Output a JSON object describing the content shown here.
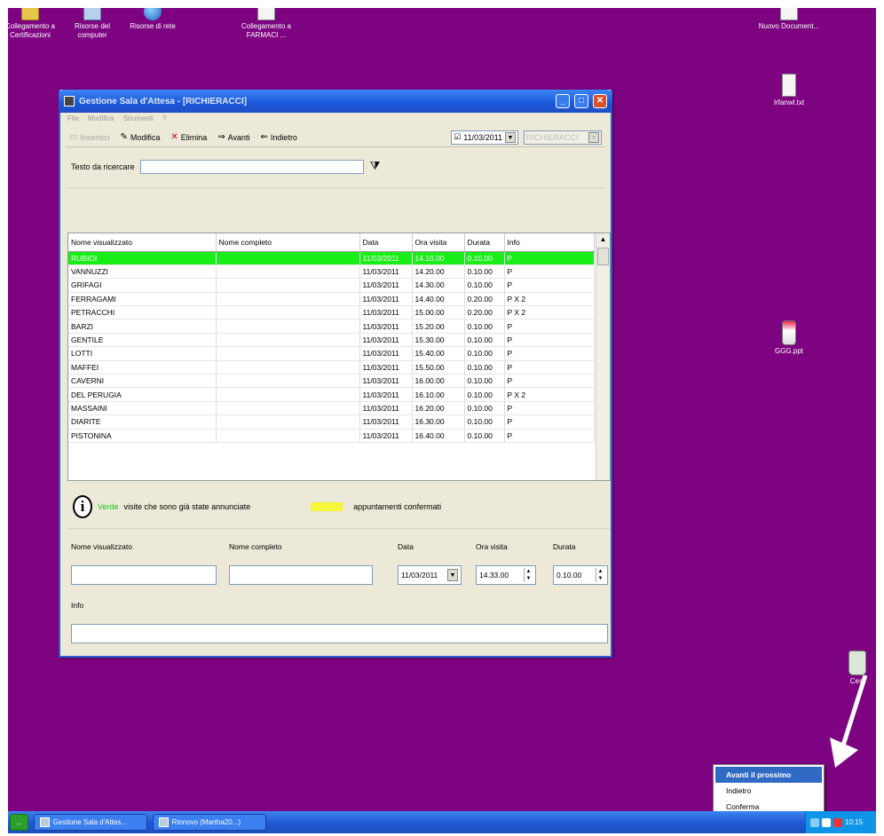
{
  "desktop": {
    "icons": [
      {
        "label": "Collegamento a Certificazioni",
        "icon": "folder-icon"
      },
      {
        "label": "Risorse del computer",
        "icon": "computer-icon"
      },
      {
        "label": "Risorse di rete",
        "icon": "network-icon"
      },
      {
        "label": "Collegamento a FARMACI ...",
        "icon": "shortcut-icon"
      },
      {
        "label": "Nuovo Document...",
        "icon": "document-icon"
      },
      {
        "label": "Irfanwl.txt",
        "icon": "text-file-icon"
      },
      {
        "label": "GGG.ppt",
        "icon": "spray-file-icon"
      },
      {
        "label": "Cest",
        "icon": "recycle-bin-icon"
      }
    ]
  },
  "window": {
    "title": "Gestione Sala d'Attesa - [RICHIERACCI]",
    "menu": [
      "File",
      "Modifica",
      "Strumenti",
      "?"
    ],
    "toolbar": {
      "nuovo": "Inserisci",
      "modifica": "Modifica",
      "elimina": "Elimina",
      "avanti": "Avanti",
      "indietro": "Indietro",
      "date": "11/03/2011",
      "doctor": "RICHIERACCI"
    },
    "search": {
      "label": "Testo da ricercare",
      "value": ""
    },
    "grid": {
      "columns": [
        "Nome visualizzato",
        "Nome completo",
        "Data",
        "Ora visita",
        "Durata",
        "Info"
      ],
      "rows": [
        [
          "RUBIOI",
          "",
          "11/03/2011",
          "14.10.00",
          "0.10.00",
          "P"
        ],
        [
          "VANNUZZI",
          "",
          "11/03/2011",
          "14.20.00",
          "0.10.00",
          "P"
        ],
        [
          "GRIFAGI",
          "",
          "11/03/2011",
          "14.30.00",
          "0.10.00",
          "P"
        ],
        [
          "FERRAGAMI",
          "",
          "11/03/2011",
          "14.40.00",
          "0.20.00",
          "P X 2"
        ],
        [
          "PETRACCHI",
          "",
          "11/03/2011",
          "15.00.00",
          "0.20.00",
          "P X 2"
        ],
        [
          "BARZI",
          "",
          "11/03/2011",
          "15.20.00",
          "0.10.00",
          "P"
        ],
        [
          "GENTILE",
          "",
          "11/03/2011",
          "15.30.00",
          "0.10.00",
          "P"
        ],
        [
          "LOTTI",
          "",
          "11/03/2011",
          "15.40.00",
          "0.10.00",
          "P"
        ],
        [
          "MAFFEI",
          "",
          "11/03/2011",
          "15.50.00",
          "0.10.00",
          "P"
        ],
        [
          "CAVERNI",
          "",
          "11/03/2011",
          "16.00.00",
          "0.10.00",
          "P"
        ],
        [
          "DEL PERUGIA",
          "",
          "11/03/2011",
          "16.10.00",
          "0.10.00",
          "P X 2"
        ],
        [
          "MASSAINI",
          "",
          "11/03/2011",
          "16.20.00",
          "0.10.00",
          "P"
        ],
        [
          "DIARITE",
          "",
          "11/03/2011",
          "16.30.00",
          "0.10.00",
          "P"
        ],
        [
          "PISTONINA",
          "",
          "11/03/2011",
          "16.40.00",
          "0.10.00",
          "P"
        ]
      ]
    },
    "legend": {
      "green_word": "Verde",
      "green_text": "visite che sono già state annunciate",
      "yellow_text": "appuntamenti confermati",
      "green_color": "#19ee19",
      "yellow_color": "#f5f53a"
    },
    "form": {
      "nome_visualizzato_label": "Nome visualizzato",
      "nome_completo_label": "Nome completo",
      "data_label": "Data",
      "ora_label": "Ora visita",
      "durata_label": "Durata",
      "info_label": "Info",
      "data_value": "11/03/2011",
      "ora_value": "14.33.00",
      "durata_value": "0.10.00",
      "nome_visualizzato_value": "",
      "nome_completo_value": "",
      "info_value": ""
    }
  },
  "taskbar": {
    "start": "...",
    "buttons": [
      "Gestione Sala d'Attes...",
      "Rinnovo (Martha20...)"
    ],
    "clock": "10:15"
  },
  "context_menu": {
    "items": [
      "Avanti il prossimo",
      "Indietro",
      "Conferma"
    ],
    "selected_index": 0
  }
}
